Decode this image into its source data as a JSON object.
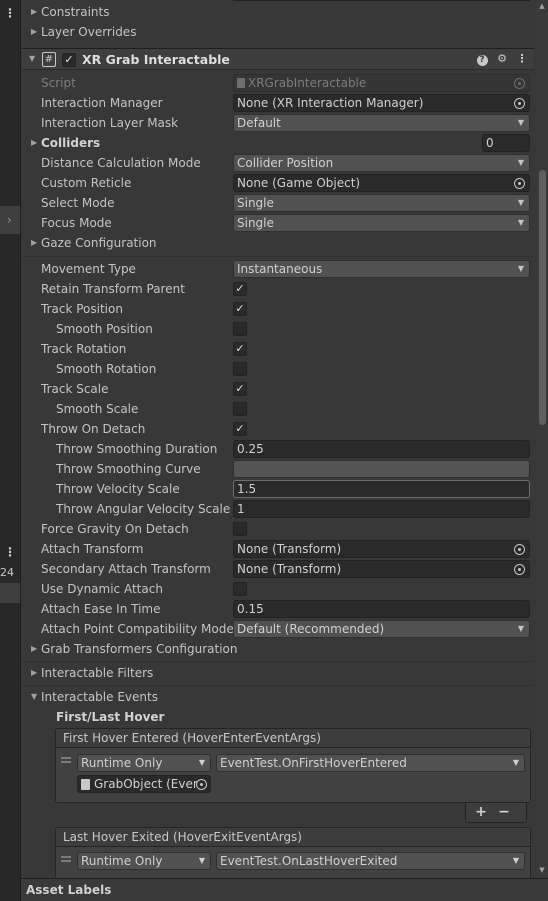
{
  "left_strip": {
    "menu_dots_top": "⋮",
    "menu_dots_mid": "⋮",
    "expand_arrow": "›",
    "side_number": "24"
  },
  "collapsed_sections": {
    "constraints": "Constraints",
    "layer_overrides": "Layer Overrides"
  },
  "component": {
    "title": "XR Grab Interactable",
    "enabled": true,
    "help_icon": "?",
    "settings_icon": "⚙",
    "menu_icon": "⋮"
  },
  "fields": {
    "script": {
      "label": "Script",
      "value": "XRGrabInteractable"
    },
    "interaction_manager": {
      "label": "Interaction Manager",
      "value": "None (XR Interaction Manager)"
    },
    "interaction_layer_mask": {
      "label": "Interaction Layer Mask",
      "value": "Default"
    },
    "colliders": {
      "label": "Colliders",
      "value": "0"
    },
    "distance_calculation_mode": {
      "label": "Distance Calculation Mode",
      "value": "Collider Position"
    },
    "custom_reticle": {
      "label": "Custom Reticle",
      "value": "None (Game Object)"
    },
    "select_mode": {
      "label": "Select Mode",
      "value": "Single"
    },
    "focus_mode": {
      "label": "Focus Mode",
      "value": "Single"
    },
    "gaze_configuration": {
      "label": "Gaze Configuration"
    },
    "movement_type": {
      "label": "Movement Type",
      "value": "Instantaneous"
    },
    "retain_transform_parent": {
      "label": "Retain Transform Parent",
      "checked": true
    },
    "track_position": {
      "label": "Track Position",
      "checked": true
    },
    "smooth_position": {
      "label": "Smooth Position",
      "checked": false
    },
    "track_rotation": {
      "label": "Track Rotation",
      "checked": true
    },
    "smooth_rotation": {
      "label": "Smooth Rotation",
      "checked": false
    },
    "track_scale": {
      "label": "Track Scale",
      "checked": true
    },
    "smooth_scale": {
      "label": "Smooth Scale",
      "checked": false
    },
    "throw_on_detach": {
      "label": "Throw On Detach",
      "checked": true
    },
    "throw_smoothing_duration": {
      "label": "Throw Smoothing Duration",
      "value": "0.25"
    },
    "throw_smoothing_curve": {
      "label": "Throw Smoothing Curve",
      "value": ""
    },
    "throw_velocity_scale": {
      "label": "Throw Velocity Scale",
      "value": "1.5"
    },
    "throw_angular_velocity_scale": {
      "label": "Throw Angular Velocity Scale",
      "value": "1"
    },
    "force_gravity_on_detach": {
      "label": "Force Gravity On Detach",
      "checked": false
    },
    "attach_transform": {
      "label": "Attach Transform",
      "value": "None (Transform)"
    },
    "secondary_attach_transform": {
      "label": "Secondary Attach Transform",
      "value": "None (Transform)"
    },
    "use_dynamic_attach": {
      "label": "Use Dynamic Attach",
      "checked": false
    },
    "attach_ease_in_time": {
      "label": "Attach Ease In Time",
      "value": "0.15"
    },
    "attach_point_compatibility_mode": {
      "label": "Attach Point Compatibility Mode",
      "value": "Default (Recommended)"
    },
    "grab_transformers_configuration": {
      "label": "Grab Transformers Configuration"
    },
    "interactable_filters": {
      "label": "Interactable Filters"
    },
    "interactable_events": {
      "label": "Interactable Events"
    }
  },
  "events": {
    "subsection_title": "First/Last Hover",
    "first_hover_entered": {
      "header": "First Hover Entered (HoverEnterEventArgs)",
      "runtime": "Runtime Only",
      "function": "EventTest.OnFirstHoverEntered",
      "object": "GrabObject (Even"
    },
    "last_hover_exited": {
      "header": "Last Hover Exited (HoverExitEventArgs)",
      "runtime": "Runtime Only",
      "function": "EventTest.OnLastHoverExited"
    },
    "add_label": "+",
    "remove_label": "−"
  },
  "bottom_bar": {
    "label": "Asset Labels"
  }
}
